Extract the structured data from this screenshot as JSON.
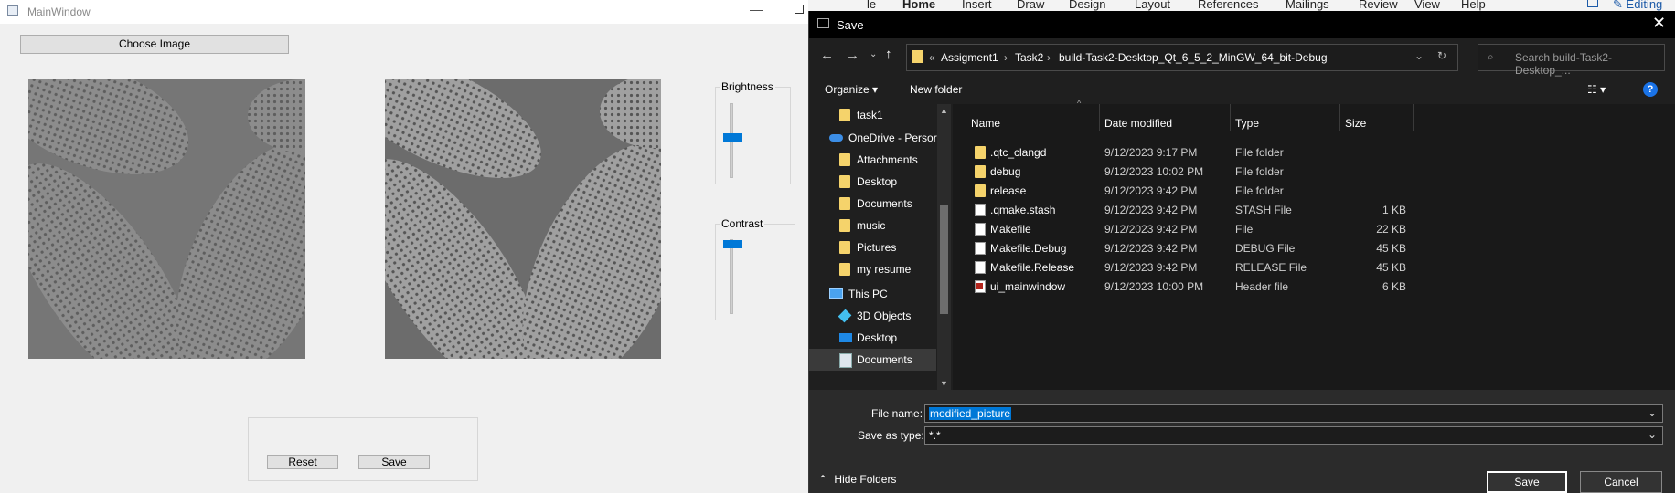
{
  "main_window": {
    "title": "MainWindow",
    "minimize_glyph": "—",
    "choose_image_label": "Choose Image",
    "brightness_label": "Brightness",
    "contrast_label": "Contrast",
    "brightness_level": 0.55,
    "contrast_level": 0.98,
    "reset_label": "Reset",
    "save_label": "Save"
  },
  "word_ribbon": {
    "tabs": [
      "le",
      "Home",
      "Insert",
      "Draw",
      "Design",
      "Layout",
      "References",
      "Mailings",
      "Review",
      "View",
      "Help"
    ],
    "editing_label": "Editing"
  },
  "save_dialog": {
    "title": "Save",
    "close_glyph": "✕",
    "breadcrumb": [
      "Assigment1",
      "Task2",
      "build-Task2-Desktop_Qt_6_5_2_MinGW_64_bit-Debug"
    ],
    "breadcrumb_prefix": "«",
    "search_placeholder": "Search build-Task2-Desktop_...",
    "organize_label": "Organize ▾",
    "new_folder_label": "New folder",
    "help_glyph": "?",
    "nav_items": [
      {
        "label": "task1",
        "icon": "folder-icon"
      },
      {
        "label": "OneDrive - Persor",
        "icon": "cloud-icon"
      },
      {
        "label": "Attachments",
        "icon": "folder-icon"
      },
      {
        "label": "Desktop",
        "icon": "folder-icon"
      },
      {
        "label": "Documents",
        "icon": "folder-icon"
      },
      {
        "label": "music",
        "icon": "folder-icon"
      },
      {
        "label": "Pictures",
        "icon": "folder-icon"
      },
      {
        "label": "my resume",
        "icon": "folder-icon"
      },
      {
        "label": "This PC",
        "icon": "computer-icon"
      },
      {
        "label": "3D Objects",
        "icon": "cube-icon"
      },
      {
        "label": "Desktop",
        "icon": "desktop-icon"
      },
      {
        "label": "Documents",
        "icon": "document-icon"
      }
    ],
    "columns": [
      "Name",
      "Date modified",
      "Type",
      "Size"
    ],
    "files": [
      {
        "name": ".qtc_clangd",
        "date": "9/12/2023 9:17 PM",
        "type": "File folder",
        "size": "",
        "icon": "folder-icon"
      },
      {
        "name": "debug",
        "date": "9/12/2023 10:02 PM",
        "type": "File folder",
        "size": "",
        "icon": "folder-icon"
      },
      {
        "name": "release",
        "date": "9/12/2023 9:42 PM",
        "type": "File folder",
        "size": "",
        "icon": "folder-icon"
      },
      {
        "name": ".qmake.stash",
        "date": "9/12/2023 9:42 PM",
        "type": "STASH File",
        "size": "1 KB",
        "icon": "file-icon"
      },
      {
        "name": "Makefile",
        "date": "9/12/2023 9:42 PM",
        "type": "File",
        "size": "22 KB",
        "icon": "file-icon"
      },
      {
        "name": "Makefile.Debug",
        "date": "9/12/2023 9:42 PM",
        "type": "DEBUG File",
        "size": "45 KB",
        "icon": "file-icon"
      },
      {
        "name": "Makefile.Release",
        "date": "9/12/2023 9:42 PM",
        "type": "RELEASE File",
        "size": "45 KB",
        "icon": "file-icon"
      },
      {
        "name": "ui_mainwindow",
        "date": "9/12/2023 10:00 PM",
        "type": "Header file",
        "size": "6 KB",
        "icon": "header-file-icon"
      }
    ],
    "file_name_label": "File name:",
    "file_name_value": "modified_picture",
    "save_as_type_label": "Save as type:",
    "save_as_type_value": "*.*",
    "hide_folders_label": "Hide Folders",
    "save_button": "Save",
    "cancel_button": "Cancel"
  }
}
